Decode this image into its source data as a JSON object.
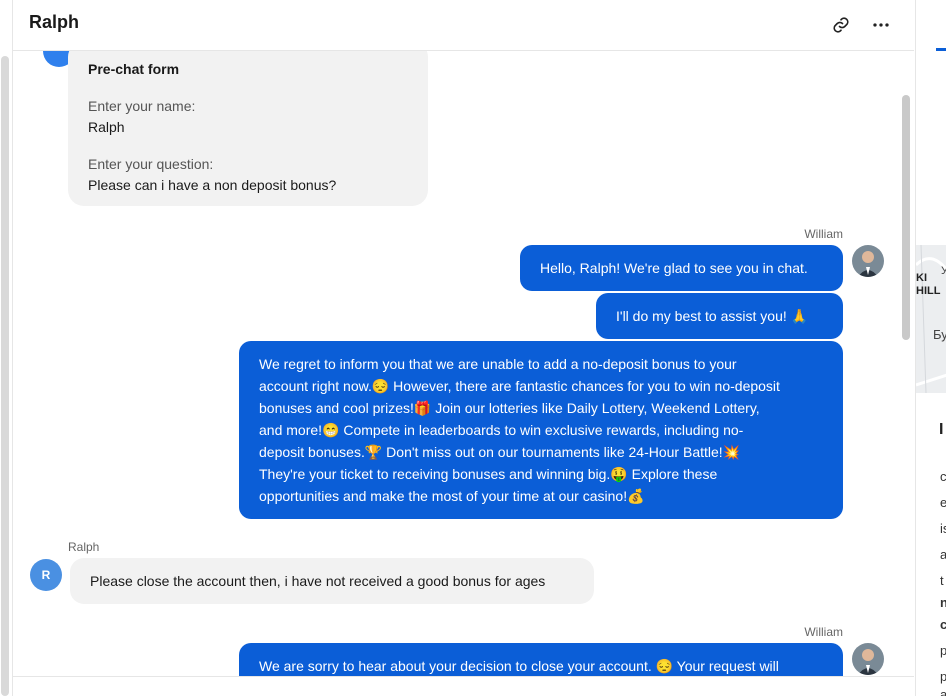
{
  "header": {
    "title": "Ralph",
    "link_icon": "link-icon",
    "more_icon": "more-horizontal-icon"
  },
  "colors": {
    "accent": "#0b5ed7",
    "incoming_bubble": "#f2f2f2",
    "user_avatar": "#4a90e2"
  },
  "prechat": {
    "title": "Pre-chat form",
    "name_label": "Enter your name:",
    "name_value": "Ralph",
    "question_label": "Enter your question:",
    "question_value": "Please can i have a non deposit bonus?"
  },
  "messages": [
    {
      "sender": "William",
      "lines": [
        "Hello, Ralph! We're glad to see you in chat."
      ]
    },
    {
      "lines": [
        "I'll do my best to assist you! 🙏"
      ]
    },
    {
      "lines": [
        "We regret to inform you that we are unable to add a no-deposit bonus to your",
        "account right now.😔 However, there are fantastic chances for you to win no-deposit",
        "bonuses and cool prizes!🎁 Join our lotteries like Daily Lottery, Weekend Lottery,",
        "and more!😁 Compete in leaderboards to win exclusive rewards, including no-",
        "deposit bonuses.🏆 Don't miss out on our tournaments like 24-Hour Battle!💥",
        "They're your ticket to receiving bonuses and winning big.🤑 Explore these",
        "opportunities and make the most of your time at our casino!💰"
      ]
    },
    {
      "sender": "Ralph",
      "avatar_initial": "R",
      "lines": [
        "Please close the account then, i have not received a good bonus for ages"
      ]
    },
    {
      "sender": "William",
      "lines": [
        "We are sorry to hear about your decision to close your account. 😔 Your request will"
      ]
    }
  ],
  "right_panel": {
    "map_labels": [
      "KI",
      "HILL",
      "У",
      "Бу"
    ],
    "heading_letter": "I",
    "letters": [
      "c",
      "e",
      "is",
      "a",
      "t",
      "n",
      "c",
      "p",
      "p",
      "a"
    ]
  }
}
